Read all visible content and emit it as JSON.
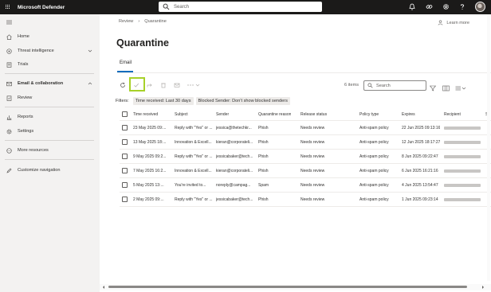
{
  "app": {
    "title": "Microsoft Defender"
  },
  "topsearch": {
    "placeholder": "Search"
  },
  "sidebar": {
    "items": [
      {
        "label": "Home",
        "icon": "home-icon"
      },
      {
        "label": "Threat intelligence",
        "icon": "threat-intel-icon",
        "expandable": true
      },
      {
        "label": "Trials",
        "icon": "trials-icon"
      },
      {
        "label": "Email & collaboration",
        "icon": "email-icon",
        "expandable": true,
        "expanded": true
      },
      {
        "label": "Review",
        "icon": "review-icon"
      },
      {
        "label": "Reports",
        "icon": "reports-icon"
      },
      {
        "label": "Settings",
        "icon": "gear-icon"
      },
      {
        "label": "More resources",
        "icon": "more-resources-icon"
      },
      {
        "label": "Customize navigation",
        "icon": "pencil-icon"
      }
    ]
  },
  "breadcrumb": {
    "items": [
      "Review",
      "Quarantine"
    ],
    "separator": "›"
  },
  "learn_more": "Learn more",
  "page": {
    "title": "Quarantine"
  },
  "tabs": {
    "email": "Email"
  },
  "toolbar": {
    "items_count": "6 items",
    "search_placeholder": "Search"
  },
  "filters": {
    "label": "Filters:",
    "pills": [
      "Time received: Last 30 days",
      "Blocked Sender: Don't show blocked senders"
    ]
  },
  "table": {
    "columns": [
      "Time received",
      "Subject",
      "Sender",
      "Quarantine reason",
      "Release status",
      "Policy type",
      "Expires",
      "Recipient",
      "Se"
    ],
    "rows": [
      {
        "time": "23 May 2025 09:...",
        "subject": "Reply with \"Yes\" or ...",
        "sender": "jessica@thetechkr...",
        "reason": "Phish",
        "status": "Needs review",
        "policy": "Anti-spam policy",
        "expires": "22 Jun 2025 09:13:16"
      },
      {
        "time": "13 May 2025 18:...",
        "subject": "Innovation & Excell...",
        "sender": "kieran@corporateli...",
        "reason": "Phish",
        "status": "Needs review",
        "policy": "Anti-spam policy",
        "expires": "12 Jun 2025 18:17:27"
      },
      {
        "time": "9 May 2025 09:2...",
        "subject": "Reply with \"Yes\" or ...",
        "sender": "jessicabaker@tech...",
        "reason": "Phish",
        "status": "Needs review",
        "policy": "Anti-spam policy",
        "expires": "8 Jun 2025 09:22:47"
      },
      {
        "time": "7 May 2025 16:2...",
        "subject": "Innovation & Excell...",
        "sender": "kieran@corporateli...",
        "reason": "Phish",
        "status": "Needs review",
        "policy": "Anti-spam policy",
        "expires": "6 Jun 2025 16:21:16"
      },
      {
        "time": "5 May 2025 13:...",
        "subject": "You're invited to...",
        "sender": "noreply@campag...",
        "reason": "Spam",
        "status": "Needs review",
        "policy": "Anti-spam policy",
        "expires": "4 Jun 2025 13:54:47"
      },
      {
        "time": "2 May 2025 09:...",
        "subject": "Reply with \"Yes\" or ...",
        "sender": "jessicabaker@tech...",
        "reason": "Phish",
        "status": "Needs review",
        "policy": "Anti-spam policy",
        "expires": "1 Jun 2025 09:23:14"
      }
    ]
  },
  "colors": {
    "topbar": "#1b1a19",
    "highlight": "#a7d129",
    "accent": "#0f6cbd"
  }
}
